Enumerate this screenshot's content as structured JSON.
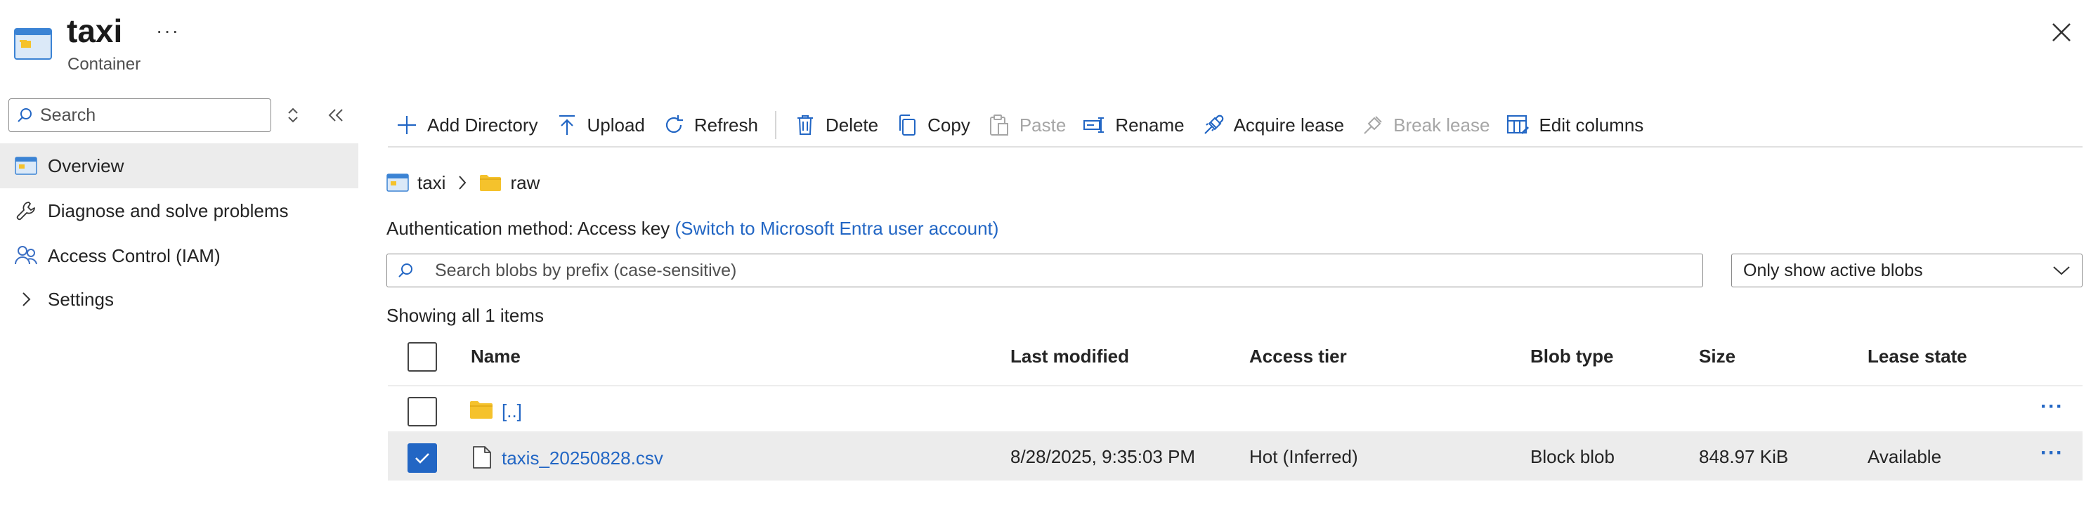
{
  "header": {
    "title": "taxi",
    "subtitle": "Container",
    "more": "···"
  },
  "sidebar": {
    "search_placeholder": "Search",
    "items": [
      {
        "label": "Overview",
        "icon": "container-icon",
        "active": true
      },
      {
        "label": "Diagnose and solve problems",
        "icon": "wrench-icon"
      },
      {
        "label": "Access Control (IAM)",
        "icon": "people-icon"
      },
      {
        "label": "Settings",
        "icon": "chevron-right-icon"
      }
    ]
  },
  "toolbar": {
    "add_directory": "Add Directory",
    "upload": "Upload",
    "refresh": "Refresh",
    "delete": "Delete",
    "copy": "Copy",
    "paste": "Paste",
    "rename": "Rename",
    "acquire_lease": "Acquire lease",
    "break_lease": "Break lease",
    "edit_columns": "Edit columns"
  },
  "breadcrumb": {
    "container": "taxi",
    "folder": "raw"
  },
  "auth": {
    "label": "Authentication method:",
    "value": "Access key",
    "switch_link": "(Switch to Microsoft Entra user account)"
  },
  "blob_search": {
    "placeholder": "Search blobs by prefix (case-sensitive)"
  },
  "filter": {
    "selected": "Only show active blobs"
  },
  "showing": "Showing all 1 items",
  "table": {
    "headers": {
      "name": "Name",
      "last_modified": "Last modified",
      "access_tier": "Access tier",
      "blob_type": "Blob type",
      "size": "Size",
      "lease_state": "Lease state"
    },
    "parent_row": {
      "name": "[..]"
    },
    "rows": [
      {
        "name": "taxis_20250828.csv",
        "last_modified": "8/28/2025, 9:35:03 PM",
        "access_tier": "Hot (Inferred)",
        "blob_type": "Block blob",
        "size": "848.97 KiB",
        "lease_state": "Available",
        "selected": true
      }
    ],
    "row_actions": "···"
  },
  "colors": {
    "accent": "#2266c4",
    "folder": "#f5c22c",
    "selected_row": "#ececec"
  }
}
